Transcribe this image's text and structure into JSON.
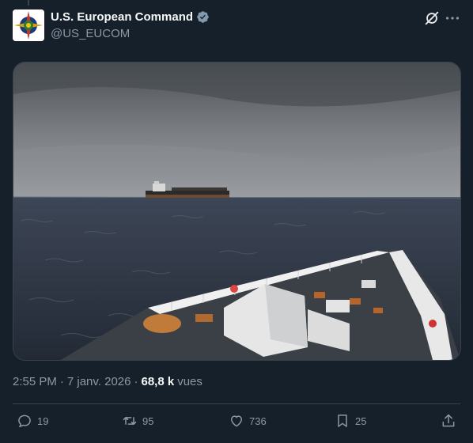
{
  "account": {
    "display_name": "U.S. European Command",
    "handle": "@US_EUCOM",
    "verified_icon": "verified-badge-icon"
  },
  "post": {
    "time": "2:55 PM",
    "separator": "·",
    "date": "7 janv. 2026",
    "views_count": "68,8 k",
    "views_label": "vues"
  },
  "actions": {
    "replies": "19",
    "reposts": "95",
    "likes": "736",
    "bookmarks": "25"
  },
  "colors": {
    "background": "#15202b",
    "text_primary": "#f7f9f9",
    "text_secondary": "#8b98a5",
    "verified": "#829aab",
    "border": "#38444d"
  },
  "icons": [
    "grok-icon",
    "more-options-icon",
    "reply-icon",
    "repost-icon",
    "like-icon",
    "bookmark-icon",
    "share-icon"
  ]
}
